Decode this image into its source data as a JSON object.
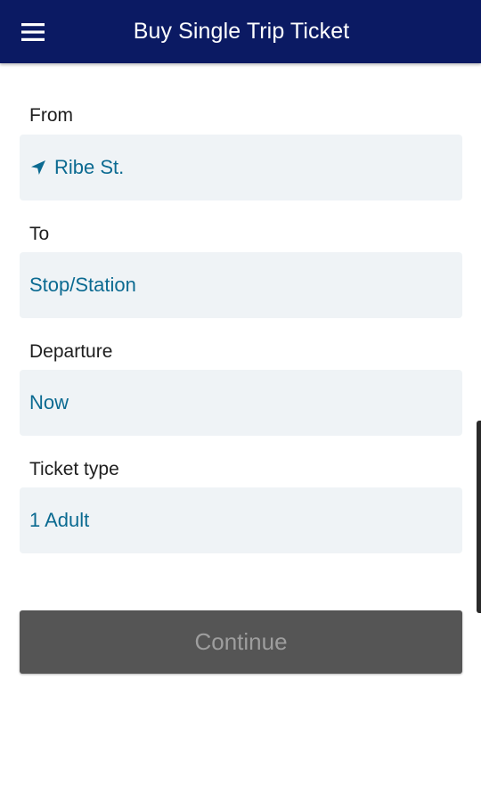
{
  "header": {
    "title": "Buy Single Trip Ticket",
    "menu_icon": "hamburger-menu-icon",
    "background_color": "#0b1a63"
  },
  "form": {
    "from": {
      "label": "From",
      "value": "Ribe St.",
      "icon": "location-arrow-icon"
    },
    "to": {
      "label": "To",
      "value": "Stop/Station"
    },
    "departure": {
      "label": "Departure",
      "value": "Now"
    },
    "ticket_type": {
      "label": "Ticket type",
      "value": "1 Adult"
    }
  },
  "actions": {
    "continue_label": "Continue",
    "continue_enabled": false
  },
  "colors": {
    "field_text": "#0b6a91",
    "field_background": "#eff3f6",
    "button_background": "#555555",
    "button_text": "#9e9e9e"
  }
}
